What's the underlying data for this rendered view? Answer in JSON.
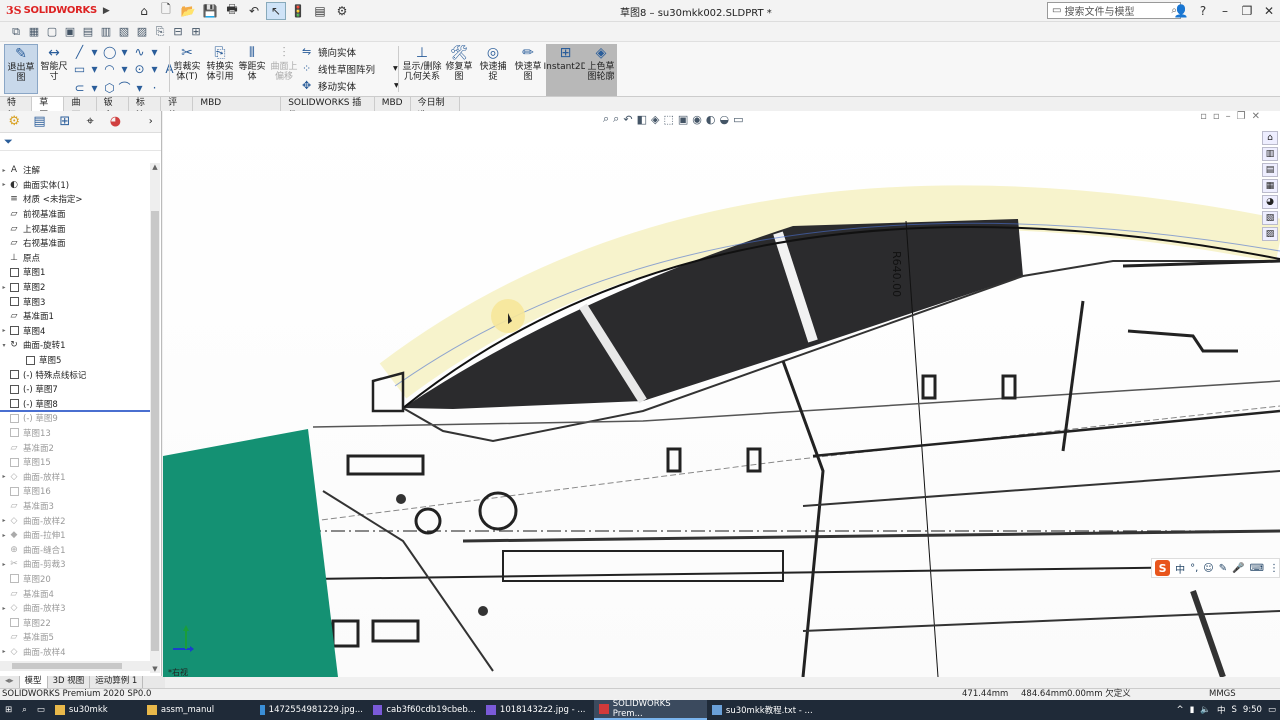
{
  "app": {
    "brand_ds": "3S",
    "brand_name": "SOLIDWORKS",
    "document_title": "草图8 – su30mkk002.SLDPRT *",
    "search_placeholder": "搜索文件与模型"
  },
  "ribbon": {
    "exit_sketch": "退出草图",
    "smart_dim": "智能尺寸",
    "trim": "剪裁实体(T)",
    "convert": "转换实体引用",
    "offset": "等距实体",
    "surface_offset": "曲面上偏移",
    "mirror": "镜向实体",
    "linear_pattern": "线性草图阵列",
    "move": "移动实体",
    "show_relations": "显示/删除几何关系",
    "repair": "修复草图",
    "quick_snap": "快速捕捉",
    "rapid_sketch": "快速草图",
    "instant2d": "Instant2D",
    "shaded_contour": "上色草图轮廓"
  },
  "tabs": [
    {
      "label": "特征"
    },
    {
      "label": "草图",
      "active": true
    },
    {
      "label": "曲面"
    },
    {
      "label": "钣金"
    },
    {
      "label": "标注"
    },
    {
      "label": "评估"
    },
    {
      "label": "MBD Dimensions"
    },
    {
      "label": "SOLIDWORKS 插件"
    },
    {
      "label": "MBD"
    },
    {
      "label": "今日制造"
    }
  ],
  "tree": [
    {
      "label": "注解",
      "icon": "annotation-icon",
      "arrow": true
    },
    {
      "label": "曲面实体(1)",
      "icon": "surface-body-icon",
      "arrow": true
    },
    {
      "label": "材质 <未指定>",
      "icon": "material-icon"
    },
    {
      "label": "前视基准面",
      "icon": "plane-icon"
    },
    {
      "label": "上视基准面",
      "icon": "plane-icon"
    },
    {
      "label": "右视基准面",
      "icon": "plane-icon"
    },
    {
      "label": "原点",
      "icon": "origin-icon"
    },
    {
      "label": "草图1",
      "icon": "sketch-icon"
    },
    {
      "label": "草图2",
      "icon": "sketch-icon",
      "arrow": true
    },
    {
      "label": "草图3",
      "icon": "sketch-icon"
    },
    {
      "label": "基准面1",
      "icon": "plane-icon"
    },
    {
      "label": "草图4",
      "icon": "sketch-icon",
      "arrow": true
    },
    {
      "label": "曲面-旋转1",
      "icon": "revolve-icon",
      "arrow": true,
      "expanded": true
    },
    {
      "label": "草图5",
      "icon": "sketch-icon",
      "indent": true
    },
    {
      "label": "(-) 特殊点线标记",
      "icon": "sketch-icon"
    },
    {
      "label": "(-) 草图7",
      "icon": "sketch-icon"
    },
    {
      "label": "(-) 草图8",
      "icon": "sketch-icon"
    },
    {
      "label": "(-) 草图9",
      "icon": "sketch-icon",
      "dim": true
    },
    {
      "label": "草图13",
      "icon": "sketch-icon",
      "dim": true
    },
    {
      "label": "基准面2",
      "icon": "plane-icon",
      "dim": true
    },
    {
      "label": "草图15",
      "icon": "sketch-icon",
      "dim": true
    },
    {
      "label": "曲面-放样1",
      "icon": "loft-icon",
      "arrow": true,
      "dim": true
    },
    {
      "label": "草图16",
      "icon": "sketch-icon",
      "dim": true
    },
    {
      "label": "基准面3",
      "icon": "plane-icon",
      "dim": true
    },
    {
      "label": "曲面-放样2",
      "icon": "loft-icon",
      "arrow": true,
      "dim": true
    },
    {
      "label": "曲面-拉伸1",
      "icon": "extrude-icon",
      "arrow": true,
      "dim": true
    },
    {
      "label": "曲面-缝合1",
      "icon": "knit-icon",
      "dim": true
    },
    {
      "label": "曲面-剪裁3",
      "icon": "trim-surface-icon",
      "arrow": true,
      "dim": true
    },
    {
      "label": "草图20",
      "icon": "sketch-icon",
      "dim": true
    },
    {
      "label": "基准面4",
      "icon": "plane-icon",
      "dim": true
    },
    {
      "label": "曲面-放样3",
      "icon": "loft-icon",
      "arrow": true,
      "dim": true
    },
    {
      "label": "草图22",
      "icon": "sketch-icon",
      "dim": true
    },
    {
      "label": "基准面5",
      "icon": "plane-icon",
      "dim": true
    },
    {
      "label": "曲面-放样4",
      "icon": "loft-icon",
      "arrow": true,
      "dim": true
    }
  ],
  "bottom_tabs": [
    {
      "label": "模型",
      "active": true
    },
    {
      "label": "3D 视图"
    },
    {
      "label": "运动算例 1"
    }
  ],
  "viewport": {
    "dimension_label": "R640.00",
    "scale_label": "*右视"
  },
  "ime": {
    "logo": "S",
    "mode": "中"
  },
  "status": {
    "product": "SOLIDWORKS Premium 2020 SP0.0",
    "x": "471.44mm",
    "y": "484.64mm",
    "z_status": "0.00mm 欠定义",
    "units": "MMGS"
  },
  "taskbar": {
    "items": [
      {
        "label": "su30mkk",
        "color": "#e8b84a"
      },
      {
        "label": "assm_manul",
        "color": "#e8b84a"
      },
      {
        "label": "1472554981229.jpg...",
        "color": "#3a8fd8"
      },
      {
        "label": "cab3f60cdb19cbeb...",
        "color": "#7a5ad8"
      },
      {
        "label": "10181432z2.jpg - ...",
        "color": "#7a5ad8"
      },
      {
        "label": "SOLIDWORKS Prem...",
        "color": "#d23a3a",
        "active": true
      },
      {
        "label": "su30mkk教程.txt - ...",
        "color": "#6aa0d8"
      }
    ],
    "tray_lang": "中",
    "clock": "9:50"
  }
}
